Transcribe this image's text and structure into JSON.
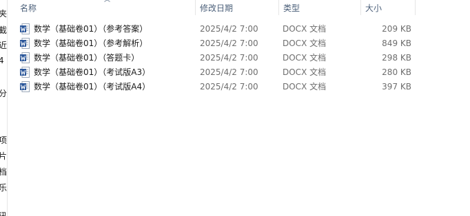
{
  "nav": {
    "items": [
      "夹",
      "截",
      "近",
      "4",
      "分",
      "项",
      "片",
      "档",
      "乐",
      "讯"
    ]
  },
  "columns": {
    "name": "名称",
    "modified": "修改日期",
    "type": "类型",
    "size": "大小"
  },
  "files": [
    {
      "icon": "word-doc-icon",
      "name": "数学（基础卷01）（参考答案）",
      "modified": "2025/4/2 7:00",
      "type": "DOCX 文档",
      "size": "209 KB"
    },
    {
      "icon": "word-doc-icon",
      "name": "数学（基础卷01）（参考解析）",
      "modified": "2025/4/2 7:00",
      "type": "DOCX 文档",
      "size": "849 KB"
    },
    {
      "icon": "word-doc-icon",
      "name": "数学（基础卷01）（答题卡）",
      "modified": "2025/4/2 7:00",
      "type": "DOCX 文档",
      "size": "298 KB"
    },
    {
      "icon": "word-doc-icon",
      "name": "数学（基础卷01）（考试版A3）",
      "modified": "2025/4/2 7:00",
      "type": "DOCX 文档",
      "size": "280 KB"
    },
    {
      "icon": "word-doc-icon",
      "name": "数学（基础卷01）（考试版A4）",
      "modified": "2025/4/2 7:00",
      "type": "DOCX 文档",
      "size": "397 KB"
    }
  ],
  "colors": {
    "header_text": "#4c607a",
    "word_icon_blue": "#2b579a",
    "secondary_text": "#6d6d6d"
  }
}
